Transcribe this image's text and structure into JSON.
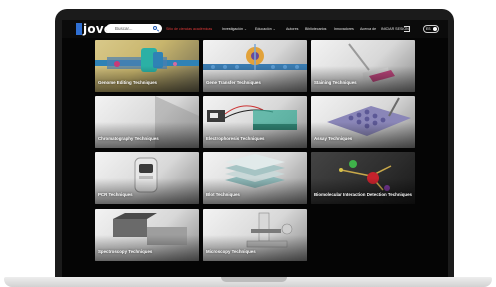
{
  "header": {
    "logo_text": "jove",
    "search_placeholder": "Buscar...",
    "nav": [
      {
        "label": "Sitio de ciencias académicas",
        "accent": true
      },
      {
        "label": "Investigación",
        "dropdown": true
      },
      {
        "label": "Educación",
        "dropdown": true
      },
      {
        "label": "Autores"
      },
      {
        "label": "Bibliotecarios"
      },
      {
        "label": "Innovadores"
      },
      {
        "label": "Acerca de"
      },
      {
        "label": "INICIAR SESIÓN"
      }
    ],
    "toggle_label": "ES"
  },
  "cards": [
    {
      "label": "Genome Editing Techniques",
      "icon": "dna-editing-illustration"
    },
    {
      "label": "Gene Transfer Techniques",
      "icon": "membrane-transfer-illustration"
    },
    {
      "label": "Staining Techniques",
      "icon": "staining-dropper-illustration"
    },
    {
      "label": "Chromatography Techniques",
      "icon": "chromatography-column-illustration"
    },
    {
      "label": "Electrophoresis Techniques",
      "icon": "gel-box-illustration"
    },
    {
      "label": "Assay Techniques",
      "icon": "well-plate-illustration"
    },
    {
      "label": "PCR Techniques",
      "icon": "thermocycler-illustration"
    },
    {
      "label": "Blot Techniques",
      "icon": "blot-membrane-illustration"
    },
    {
      "label": "Biomolecular Interaction Detection Techniques",
      "icon": "molecule-illustration"
    },
    {
      "label": "Spectroscopy Techniques",
      "icon": "spectrometer-illustration"
    },
    {
      "label": "Microscopy Techniques",
      "icon": "microscope-illustration"
    }
  ],
  "colors": {
    "accent_red": "#e23a3a",
    "logo_blue": "#2f6fd3",
    "screen_bg": "#050505"
  }
}
